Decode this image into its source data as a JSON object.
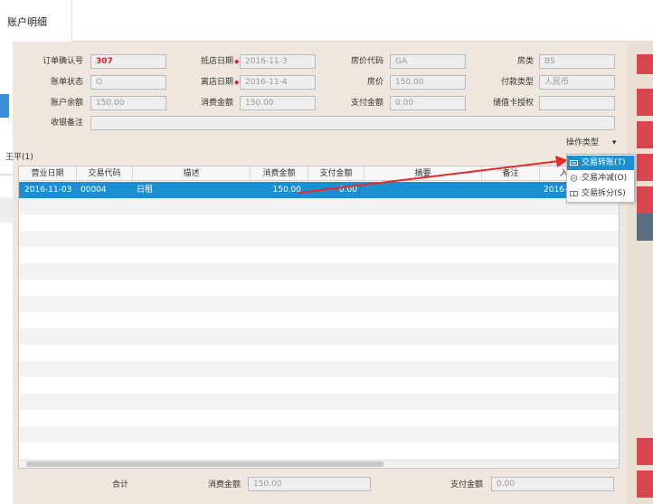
{
  "tab": {
    "title": "账户明细"
  },
  "form": {
    "order_no_label": "订单确认号",
    "order_no": "307",
    "arrival_label": "抵店日期",
    "arrival": "2016-11-3",
    "rate_code_label": "房价代码",
    "rate_code": "GA",
    "room_type_label": "房类",
    "room_type": "BS",
    "status_label": "账单状态",
    "status": "O",
    "departure_label": "离店日期",
    "departure": "2016-11-4",
    "price_label": "房价",
    "price": "150.00",
    "pay_type_label": "付款类型",
    "pay_type": "人民币",
    "balance_label": "账户余额",
    "balance": "150.00",
    "consume_label": "消费金额",
    "consume": "150.00",
    "paid_label": "支付金额",
    "paid": "0.00",
    "card_auth_label": "储值卡授权",
    "card_auth": "",
    "remark_label": "收银备注",
    "remark": ""
  },
  "guest_label": "王平(1)",
  "operation": {
    "label": "操作类型",
    "arrow": "▾"
  },
  "menu": {
    "items": [
      {
        "label": "交易转账(T)",
        "icon": "transfer-icon"
      },
      {
        "label": "交易冲减(O)",
        "icon": "offset-icon"
      },
      {
        "label": "交易拆分(S)",
        "icon": "split-icon"
      }
    ]
  },
  "table": {
    "columns": [
      "营业日期",
      "交易代码",
      "描述",
      "消费金额",
      "支付金额",
      "摘要",
      "备注",
      "入"
    ],
    "rows": [
      {
        "date": "2016-11-03",
        "code": "00004",
        "desc": "日租",
        "consume": "150.00",
        "paid": "0.00",
        "summary": "",
        "remark": "",
        "in": "2016-"
      }
    ]
  },
  "footer": {
    "total_label": "合计",
    "consume_label": "消费金额",
    "consume": "150.00",
    "paid_label": "支付金额",
    "paid": "0.00"
  },
  "colors": {
    "accent": "#1b8fd0",
    "panel": "#efe7dd",
    "alert": "#e02020",
    "side_button": "#d8454f"
  }
}
